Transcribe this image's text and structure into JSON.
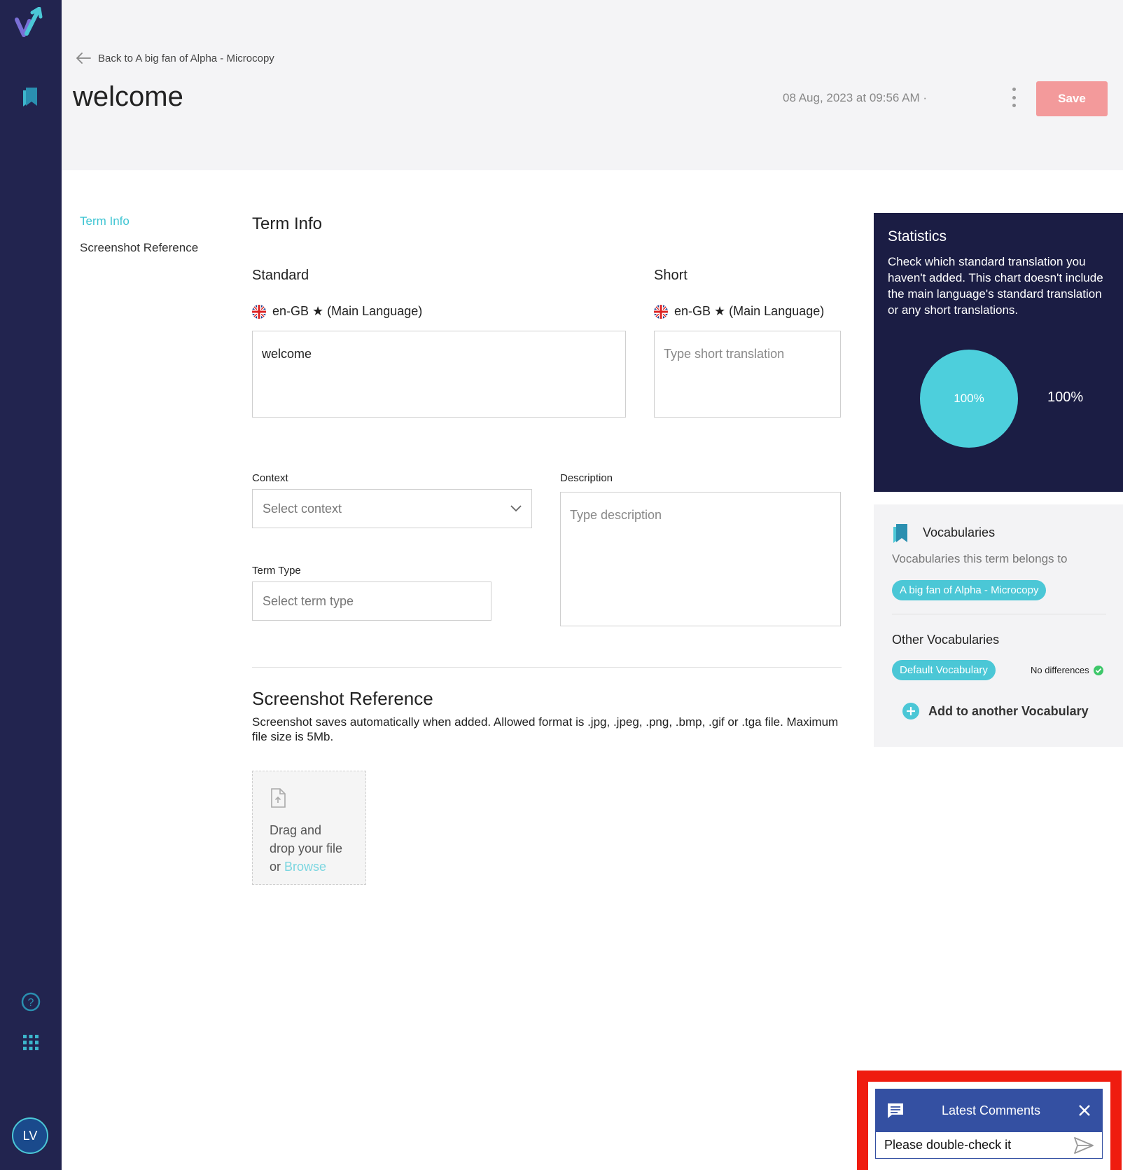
{
  "header": {
    "back_label": "Back to A big fan of Alpha - Microcopy",
    "title": "welcome",
    "timestamp": "08 Aug, 2023 at 09:56 AM ·",
    "save_label": "Save"
  },
  "left_nav": {
    "items": [
      {
        "label": "Term Info",
        "active": true
      },
      {
        "label": "Screenshot Reference",
        "active": false
      }
    ]
  },
  "term_info": {
    "section_title": "Term Info",
    "standard": {
      "label": "Standard",
      "language": "en-GB ★ (Main Language)",
      "value": "welcome"
    },
    "short": {
      "label": "Short",
      "language": "en-GB ★ (Main Language)",
      "placeholder": "Type short translation"
    },
    "context": {
      "label": "Context",
      "placeholder": "Select context"
    },
    "description": {
      "label": "Description",
      "placeholder": "Type description"
    },
    "term_type": {
      "label": "Term Type",
      "placeholder": "Select term type"
    }
  },
  "screenshot": {
    "title": "Screenshot Reference",
    "description": "Screenshot saves automatically when added. Allowed format is .jpg, .jpeg, .png, .bmp, .gif or .tga file. Maximum file size is 5Mb.",
    "drop_text": "Drag and drop your file or",
    "browse_label": "Browse"
  },
  "statistics": {
    "title": "Statistics",
    "description": "Check which standard translation you haven't added. This chart doesn't include the main language's standard translation or any short translations.",
    "pie_label": "100%",
    "side_label": "100%"
  },
  "chart_data": {
    "type": "pie",
    "categories": [
      ""
    ],
    "values": [
      100
    ],
    "labels": [
      "100%"
    ]
  },
  "vocabularies": {
    "title": "Vocabularies",
    "subtitle": "Vocabularies this term belongs to",
    "current": "A big fan of Alpha - Microcopy",
    "other_title": "Other Vocabularies",
    "other": "Default Vocabulary",
    "status": "No differences",
    "add_label": "Add to another Vocabulary"
  },
  "comments": {
    "title": "Latest Comments",
    "input_value": "Please double-check it"
  },
  "user": {
    "initials": "LV"
  },
  "colors": {
    "sidebar": "#22244f",
    "accent": "#4bc7d6",
    "save": "#f39a9b",
    "stats_bg": "#1b1d44",
    "comment_header": "#3450a2",
    "highlight": "#ef1c0f"
  }
}
